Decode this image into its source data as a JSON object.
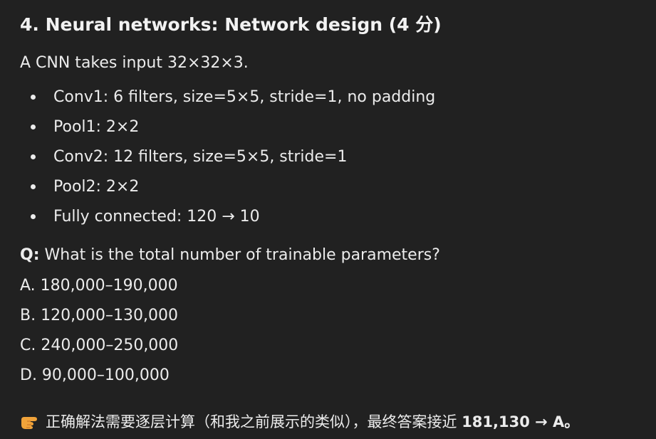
{
  "heading": "4. Neural networks: Network design (4 分)",
  "intro": "A CNN takes input 32×32×3.",
  "layers": [
    "Conv1: 6 filters, size=5×5, stride=1, no padding",
    "Pool1: 2×2",
    "Conv2: 12 filters, size=5×5, stride=1",
    "Pool2: 2×2",
    "Fully connected: 120 → 10"
  ],
  "question": {
    "label": "Q:",
    "text": " What is the total number of trainable parameters?"
  },
  "options": [
    "A. 180,000–190,000",
    "B. 120,000–130,000",
    "C. 240,000–250,000",
    "D. 90,000–100,000"
  ],
  "answer": {
    "icon": "pointing-hand-icon",
    "text": "正确解法需要逐层计算（和我之前展示的类似），最终答案接近 ",
    "emphasis": "181,130 → A。"
  },
  "colors": {
    "background": "#212121",
    "text": "#ececec",
    "icon": "#f0a33a"
  }
}
